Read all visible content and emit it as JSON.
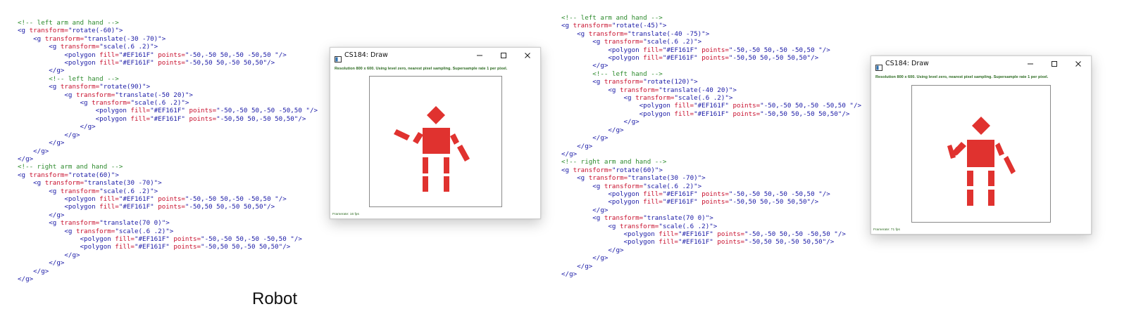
{
  "code_left": {
    "lines": [
      "<!-- left arm and hand -->",
      "<g transform=\"rotate(-60)\">",
      "    <g transform=\"translate(-30 -70)\">",
      "        <g transform=\"scale(.6 .2)\">",
      "            <polygon fill=\"#EF161F\" points=\"-50,-50 50,-50 -50,50 \"/>",
      "            <polygon fill=\"#EF161F\" points=\"-50,50 50,-50 50,50\"/>",
      "        </g>",
      "        <!-- left hand -->",
      "        <g transform=\"rotate(90)\">",
      "            <g transform=\"translate(-50 20)\">",
      "                <g transform=\"scale(.6 .2)\">",
      "                    <polygon fill=\"#EF161F\" points=\"-50,-50 50,-50 -50,50 \"/>",
      "                    <polygon fill=\"#EF161F\" points=\"-50,50 50,-50 50,50\"/>",
      "                </g>",
      "            </g>",
      "        </g>",
      "    </g>",
      "</g>",
      "<!-- right arm and hand -->",
      "<g transform=\"rotate(60)\">",
      "    <g transform=\"translate(30 -70)\">",
      "        <g transform=\"scale(.6 .2)\">",
      "            <polygon fill=\"#EF161F\" points=\"-50,-50 50,-50 -50,50 \"/>",
      "            <polygon fill=\"#EF161F\" points=\"-50,50 50,-50 50,50\"/>",
      "        </g>",
      "        <g transform=\"translate(70 0)\">",
      "            <g transform=\"scale(.6 .2)\">",
      "                <polygon fill=\"#EF161F\" points=\"-50,-50 50,-50 -50,50 \"/>",
      "                <polygon fill=\"#EF161F\" points=\"-50,50 50,-50 50,50\"/>",
      "            </g>",
      "        </g>",
      "    </g>",
      "</g>"
    ]
  },
  "code_right": {
    "lines": [
      "<!-- left arm and hand -->",
      "<g transform=\"rotate(-45)\">",
      "    <g transform=\"translate(-40 -75)\">",
      "        <g transform=\"scale(.6 .2)\">",
      "            <polygon fill=\"#EF161F\" points=\"-50,-50 50,-50 -50,50 \"/>",
      "            <polygon fill=\"#EF161F\" points=\"-50,50 50,-50 50,50\"/>",
      "        </g>",
      "        <!-- left hand -->",
      "        <g transform=\"rotate(120)\">",
      "            <g transform=\"translate(-40 20)\">",
      "                <g transform=\"scale(.6 .2)\">",
      "                    <polygon fill=\"#EF161F\" points=\"-50,-50 50,-50 -50,50 \"/>",
      "                    <polygon fill=\"#EF161F\" points=\"-50,50 50,-50 50,50\"/>",
      "                </g>",
      "            </g>",
      "        </g>",
      "    </g>",
      "</g>",
      "<!-- right arm and hand -->",
      "<g transform=\"rotate(60)\">",
      "    <g transform=\"translate(30 -70)\">",
      "        <g transform=\"scale(.6 .2)\">",
      "            <polygon fill=\"#EF161F\" points=\"-50,-50 50,-50 -50,50 \"/>",
      "            <polygon fill=\"#EF161F\" points=\"-50,50 50,-50 50,50\"/>",
      "        </g>",
      "        <g transform=\"translate(70 0)\">",
      "            <g transform=\"scale(.6 .2)\">",
      "                <polygon fill=\"#EF161F\" points=\"-50,-50 50,-50 -50,50 \"/>",
      "                <polygon fill=\"#EF161F\" points=\"-50,50 50,-50 50,50\"/>",
      "            </g>",
      "        </g>",
      "    </g>",
      "</g>"
    ]
  },
  "window_left": {
    "title": "CS184: Draw",
    "status": "Resolution 800 x 600. Using level zero, nearest pixel sampling. Supersample rate 1 per pixel.",
    "framerate": "Framerate: 16 fps"
  },
  "window_right": {
    "title": "CS184: Draw",
    "status": "Resolution 800 x 600. Using level zero, nearest pixel sampling. Supersample rate 1 per pixel.",
    "framerate": "Framerate: 71 fps"
  },
  "caption": "Robot",
  "colors": {
    "robot_fill": "#E0322F",
    "comment": "#2E8B2E",
    "tag": "#1A1AA6",
    "attr_value": "#C8102E",
    "status_text": "#2D6B22"
  },
  "icons": {
    "app": "app-window-icon",
    "minimize": "minimize-icon",
    "maximize": "maximize-icon",
    "close": "close-icon"
  }
}
